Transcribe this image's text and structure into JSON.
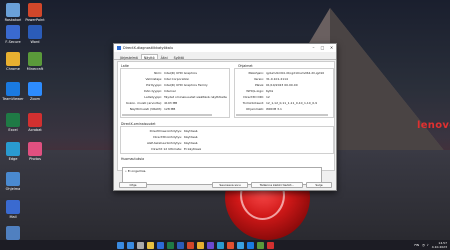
{
  "desktop": {
    "brand_text": "lenovo",
    "icons": [
      {
        "label": "Roskakori",
        "color": "#6aa0d8"
      },
      {
        "label": "PowerPoint",
        "color": "#d2472a"
      },
      {
        "label": "F-Secure",
        "color": "#3a6ad0"
      },
      {
        "label": "Word",
        "color": "#2b5cb8"
      },
      {
        "label": "Chrome",
        "color": "#e8b030"
      },
      {
        "label": "Minecraft",
        "color": "#5a9a3a"
      },
      {
        "label": "TeamViewer",
        "color": "#1a7ae0"
      },
      {
        "label": "Zoom",
        "color": "#2d8cff"
      },
      {
        "label": "Excel",
        "color": "#1f7a45"
      },
      {
        "label": "Acrobat",
        "color": "#d23030"
      },
      {
        "label": "Edge",
        "color": "#2a9ad0"
      },
      {
        "label": "Photos",
        "color": "#e05080"
      },
      {
        "label": "Ohjelma",
        "color": "#4a8ad0"
      },
      {
        "label": "Mail",
        "color": "#3a6ad0"
      },
      {
        "label": "Tiedosto",
        "color": "#5080c0"
      }
    ]
  },
  "window": {
    "title": "DirectX-diagnostiikkatyökalu",
    "minimize": "–",
    "maximize": "□",
    "close": "✕",
    "tabs": [
      "Järjestelmä",
      "Näyttö",
      "Ääni",
      "Syöttö"
    ],
    "active_tab": "Näyttö",
    "device_section": "Laite",
    "drivers_section": "Ohjaimet",
    "device_rows": [
      {
        "key": "Nimi:",
        "value": "Intel(R) UHD Graphics"
      },
      {
        "key": "Valmistaja:",
        "value": "Intel Corporation"
      },
      {
        "key": "Piirityyppi:",
        "value": "Intel(R) UHD Graphics Family"
      },
      {
        "key": "DAC-tyyppi:",
        "value": "Internal"
      },
      {
        "key": "Laitetyyppi:",
        "value": "Täydet ominaisuudet sisältävä näyttölaite"
      },
      {
        "key": "Kokon. muisti (arviolta):",
        "value": "4193 MB"
      },
      {
        "key": "Näyttömuisti (VRAM):",
        "value": "128 MB"
      }
    ],
    "driver_rows": [
      {
        "key": "Pääohjain:",
        "value": "igdumdim64.dll,igd10iumd64.dll,igd10"
      },
      {
        "key": "Versio:",
        "value": "31.0.101.2114"
      },
      {
        "key": "Päivä:",
        "value": "01/10/2023 00.00.00"
      },
      {
        "key": "WHQL-logo:",
        "value": "Kyllä"
      },
      {
        "key": "Direct3D DDI:",
        "value": "12"
      },
      {
        "key": "Toimintotasot:",
        "value": "12_1,12_0,11_1,11_0,10_1,10_0,9"
      },
      {
        "key": "Ohjainmalli:",
        "value": "WDDM 3.1"
      }
    ],
    "directx_section": "DirectX-ominaisuudet",
    "directx_rows": [
      {
        "key": "DirectDraw-kiihdytys:",
        "value": "Käytössä"
      },
      {
        "key": "Direct3D-kiihdytys:",
        "value": "Käytössä"
      },
      {
        "key": "AGP-tekstuurikiihdytys:",
        "value": "Käytössä"
      },
      {
        "key": "DirectX 12 Ultimate:",
        "value": "Ei käytössä"
      }
    ],
    "notes_section": "Huomautuksia",
    "notes_text": "Ei ongelmia.",
    "buttons": {
      "help": "Ohje",
      "next": "Seuraava sivu",
      "save": "Tallenna kaikki tiedot...",
      "exit": "Sulje"
    }
  },
  "taskbar": {
    "items": [
      "#3a8ae0",
      "#aaaaaa",
      "#e8c040",
      "#2d6ad8",
      "#1f7a45",
      "#2b5cb8",
      "#d2472a",
      "#e8b030",
      "#6a4ad0",
      "#2a9ad0",
      "#e05030",
      "#3aa0e0",
      "#1a7ae0",
      "#5a9a3a",
      "#d23030"
    ],
    "language": "FIN",
    "time": "14.57",
    "date": "4.10.2023"
  }
}
